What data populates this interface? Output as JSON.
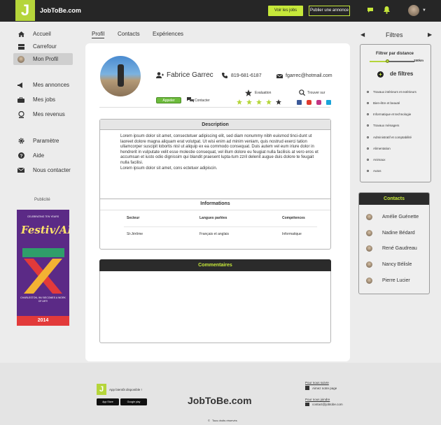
{
  "header": {
    "logo_letter": "J",
    "brand": "JobToBe.com",
    "btn_jobs": "Voir les jobs",
    "btn_post": "Publier une annonce",
    "icons": [
      "chat-icon",
      "bell-icon",
      "avatar",
      "chevron-down-icon"
    ]
  },
  "sidebar": {
    "items": [
      {
        "label": "Accueil",
        "icon": "home-icon"
      },
      {
        "label": "Carrefour",
        "icon": "board-icon"
      },
      {
        "label": "Mon Profil",
        "icon": "avatar"
      },
      {
        "label": "Mes annonces",
        "icon": "megaphone-icon"
      },
      {
        "label": "Mes jobs",
        "icon": "briefcase-icon"
      },
      {
        "label": "Mes revenus",
        "icon": "money-icon"
      },
      {
        "label": "Paramètre",
        "icon": "gear-icon"
      },
      {
        "label": "Aide",
        "icon": "help-icon"
      },
      {
        "label": "Nous contacter",
        "icon": "mail-icon"
      }
    ],
    "pub_label": "Publicité",
    "ad": {
      "line1": "CELEBRATING TEN YEARS",
      "title": "Festiv/ALL",
      "line2": "CHARLESTON, WV BECOMES A WORK OF ART!",
      "year": "2014"
    }
  },
  "tabs": [
    "Profil",
    "Contacts",
    "Expériences"
  ],
  "profile": {
    "name": "Fabrice Garrec",
    "phone": "819-681-6187",
    "email": "fgarrec@hotmail.com",
    "eval_label": "Evaluation",
    "find_label": "Trouver sur",
    "call_btn": "Appeler",
    "contact_label": "Contacter",
    "rating": 5,
    "colors": {
      "star": "#b5d53a",
      "accent": "#c6e83a"
    }
  },
  "description": {
    "title": "Description",
    "text": "Lorem ipsum dolor sit amet, consectetuer adipiscing elit, sed diam nonummy nibh euismod tinci-dunt ut laoreet dolore magna aliquam erat volutpat. Ut wisi enim ad minim veniam, quis nostrud exerci tation ullamcorper suscipit lobortis nisl ut aliquip ex ea commodo consequat. Duis autem vel eum iriure dolor in hendrerit in vulputate velit esse molestie consequat, vel illum dolore eu feugiat nulla facilisis at vero eros et accumsan et iusto odio dignissim qui blandit praesent lupta-tum zzril delenit augue duis dolore te feugait nulla facilisi.",
    "text2": "Lorem ipsum dolor sit amet, cons ectetuer adipiscin."
  },
  "info": {
    "title": "Informations",
    "headers": [
      "Secteur",
      "Langues parlées",
      "Compétences"
    ],
    "values": [
      "St-Jérôme",
      "Français et anglais",
      "Informatique"
    ]
  },
  "comments": {
    "title": "Commentaires"
  },
  "filters": {
    "title": "Filtres",
    "distance_label": "Filtrer par distance",
    "distance_value": "150km",
    "distance_fraction": 0.4,
    "more_label": "de filtres",
    "categories": [
      "Travaux intérieurs et extérieurs",
      "Bien-être et beauté",
      "Informatique et technologie",
      "Travaux ménagers",
      "Administratif et comptabilité",
      "Alimentation",
      "Animaux",
      "Autos"
    ]
  },
  "contacts": {
    "title": "Contacts",
    "items": [
      "Amélie Guénette",
      "Nadine Bédard",
      "René Gaudreau",
      "Nancy Bélisle",
      "Pierre Lucier"
    ]
  },
  "footer": {
    "app_text": "App bientôt disponible !",
    "appstore": "App Store",
    "googleplay": "Google play",
    "brand": "JobToBe.com",
    "follow": "Pour nous suivre",
    "fb": "Aimez notre page",
    "join": "Pour nous joindre",
    "mail": "contact@jobtobe.com",
    "copyright": "Tous droits réservés"
  }
}
